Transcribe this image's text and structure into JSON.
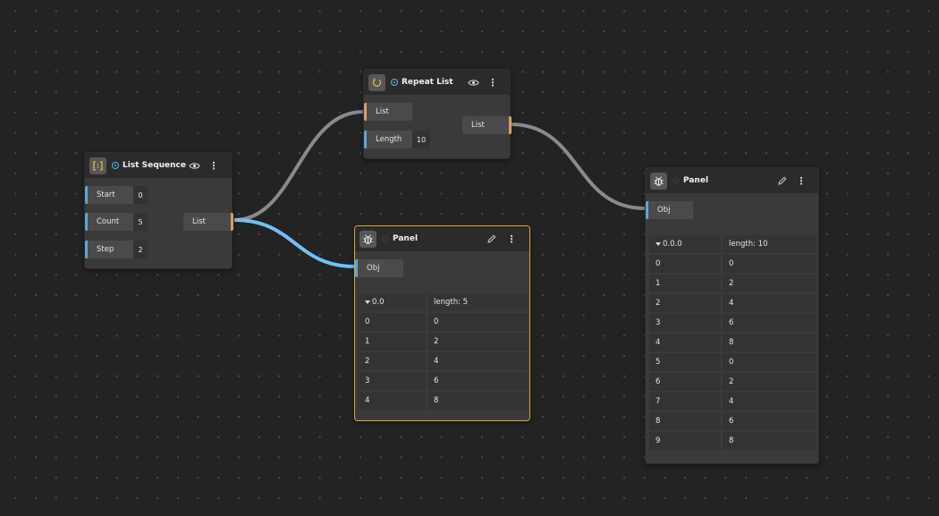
{
  "nodes": {
    "list_sequence": {
      "title": "List Sequence",
      "inputs": [
        {
          "label": "Start",
          "value": "0"
        },
        {
          "label": "Count",
          "value": "5"
        },
        {
          "label": "Step",
          "value": "2"
        }
      ],
      "output": "List"
    },
    "repeat_list": {
      "title": "Repeat List",
      "inputs": [
        {
          "label": "List"
        },
        {
          "label": "Length",
          "value": "10"
        }
      ],
      "output": "List"
    },
    "panel_small": {
      "title": "Panel",
      "input": "Obj",
      "header": {
        "key": "0.0",
        "info": "length: 5"
      },
      "rows": [
        {
          "index": "0",
          "value": "0"
        },
        {
          "index": "1",
          "value": "2"
        },
        {
          "index": "2",
          "value": "4"
        },
        {
          "index": "3",
          "value": "6"
        },
        {
          "index": "4",
          "value": "8"
        }
      ]
    },
    "panel_large": {
      "title": "Panel",
      "input": "Obj",
      "header": {
        "key": "0.0.0",
        "info": "length: 10"
      },
      "rows": [
        {
          "index": "0",
          "value": "0"
        },
        {
          "index": "1",
          "value": "2"
        },
        {
          "index": "2",
          "value": "4"
        },
        {
          "index": "3",
          "value": "6"
        },
        {
          "index": "4",
          "value": "8"
        },
        {
          "index": "5",
          "value": "0"
        },
        {
          "index": "6",
          "value": "2"
        },
        {
          "index": "7",
          "value": "4"
        },
        {
          "index": "8",
          "value": "6"
        },
        {
          "index": "9",
          "value": "8"
        }
      ]
    }
  },
  "icons": {
    "list_sequence": "list-brackets-icon",
    "repeat_list": "repeat-loop-icon",
    "panel": "bug-icon",
    "preview": "eye-icon",
    "edit": "pencil-icon",
    "menu": "kebab-menu-icon"
  },
  "colors": {
    "canvas": "#232323",
    "node": "#3a3a3a",
    "selected_border": "#d9a73a",
    "wire_active": "#6ec2f5",
    "wire_default": "#8a8a8a",
    "input_port": "#5aa8d6",
    "output_port": "#d8a15c"
  }
}
